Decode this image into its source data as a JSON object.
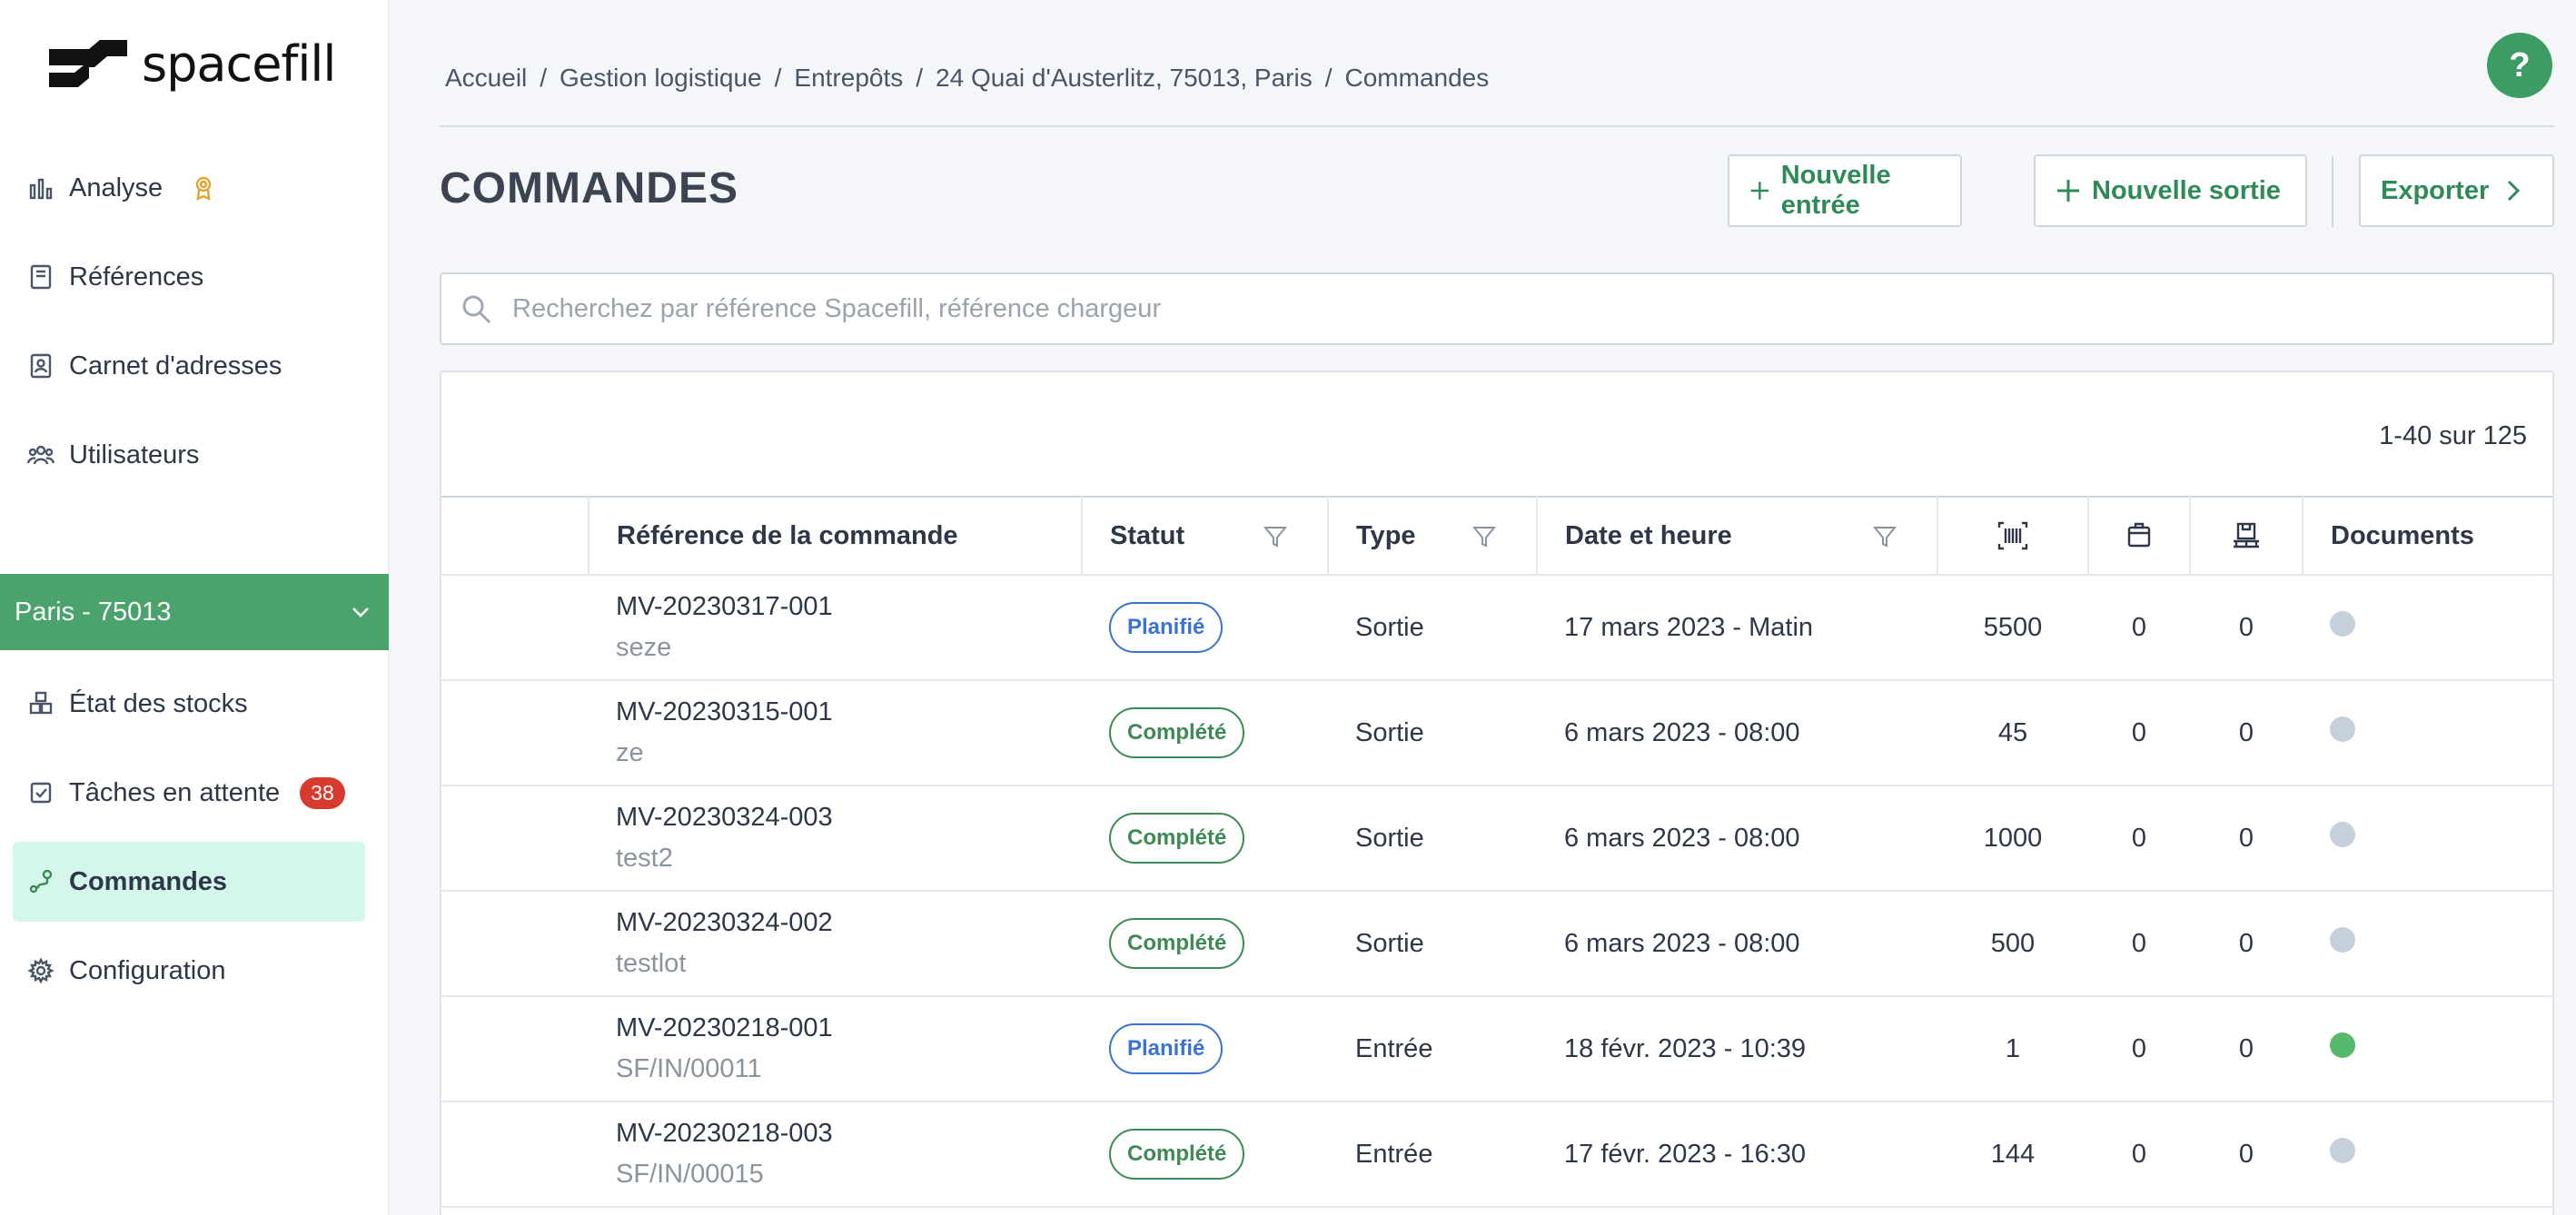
{
  "app": {
    "logo_text": "spacefill"
  },
  "sidebar": {
    "items": [
      {
        "label": "Analyse",
        "icon": "bar-chart-icon"
      },
      {
        "label": "Références",
        "icon": "book-icon"
      },
      {
        "label": "Carnet d'adresses",
        "icon": "contact-book-icon"
      },
      {
        "label": "Utilisateurs",
        "icon": "users-icon"
      }
    ],
    "warehouse": {
      "label": "Paris - 75013"
    },
    "warehouse_items": [
      {
        "label": "État des stocks",
        "icon": "boxes-icon"
      },
      {
        "label": "Tâches en attente",
        "icon": "checkbox-icon",
        "badge": "38"
      },
      {
        "label": "Commandes",
        "icon": "route-icon",
        "active": true
      },
      {
        "label": "Configuration",
        "icon": "gear-icon"
      }
    ]
  },
  "breadcrumb": [
    "Accueil",
    "Gestion logistique",
    "Entrepôts",
    "24 Quai d'Austerlitz, 75013, Paris",
    "Commandes"
  ],
  "help": {
    "label": "?"
  },
  "page": {
    "title": "COMMANDES"
  },
  "actions": {
    "new_entry": "Nouvelle entrée",
    "new_exit": "Nouvelle sortie",
    "export": "Exporter"
  },
  "search": {
    "placeholder": "Recherchez par référence Spacefill, référence chargeur",
    "value": ""
  },
  "table": {
    "pagination": "1-40 sur 125",
    "columns": {
      "reference": "Référence de la commande",
      "status": "Statut",
      "type": "Type",
      "datetime": "Date et heure",
      "documents": "Documents"
    },
    "rows": [
      {
        "ref": "MV-20230317-001",
        "sub": "seze",
        "status": "Planifié",
        "status_color": "#3b73d3",
        "type": "Sortie",
        "date": "17 mars 2023 - Matin",
        "units": "5500",
        "boxes": "0",
        "pallets": "0",
        "doc": false
      },
      {
        "ref": "MV-20230315-001",
        "sub": "ze",
        "status": "Complété",
        "status_color": "#3d8a55",
        "type": "Sortie",
        "date": "6 mars 2023 - 08:00",
        "units": "45",
        "boxes": "0",
        "pallets": "0",
        "doc": false
      },
      {
        "ref": "MV-20230324-003",
        "sub": "test2",
        "status": "Complété",
        "status_color": "#3d8a55",
        "type": "Sortie",
        "date": "6 mars 2023 - 08:00",
        "units": "1000",
        "boxes": "0",
        "pallets": "0",
        "doc": false
      },
      {
        "ref": "MV-20230324-002",
        "sub": "testlot",
        "status": "Complété",
        "status_color": "#3d8a55",
        "type": "Sortie",
        "date": "6 mars 2023 - 08:00",
        "units": "500",
        "boxes": "0",
        "pallets": "0",
        "doc": false
      },
      {
        "ref": "MV-20230218-001",
        "sub": "SF/IN/00011",
        "status": "Planifié",
        "status_color": "#3b73d3",
        "type": "Entrée",
        "date": "18 févr. 2023 - 10:39",
        "units": "1",
        "boxes": "0",
        "pallets": "0",
        "doc": true
      },
      {
        "ref": "MV-20230218-003",
        "sub": "SF/IN/00015",
        "status": "Complété",
        "status_color": "#3d8a55",
        "type": "Entrée",
        "date": "17 févr. 2023 - 16:30",
        "units": "144",
        "boxes": "0",
        "pallets": "0",
        "doc": false
      }
    ]
  },
  "colors": {
    "brand_green": "#3d9c64",
    "warehouse_bar": "#4aa36c",
    "active_bg": "#d5f7eb",
    "badge_red": "#d83a2e"
  }
}
